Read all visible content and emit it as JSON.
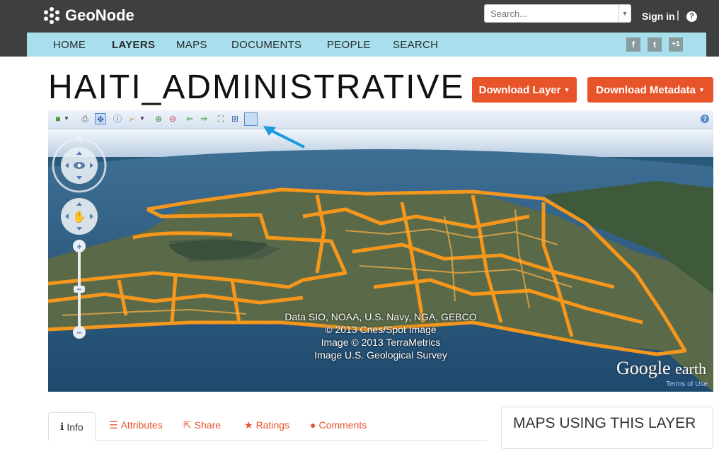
{
  "brand": {
    "name": "GeoNode"
  },
  "search": {
    "placeholder": "Search..."
  },
  "header": {
    "signin": "Sign in",
    "separator": "|",
    "help": "?"
  },
  "nav": {
    "items": [
      {
        "label": "HOME",
        "active": false
      },
      {
        "label": "LAYERS",
        "active": true
      },
      {
        "label": "MAPS",
        "active": false
      },
      {
        "label": "DOCUMENTS",
        "active": false
      },
      {
        "label": "PEOPLE",
        "active": false
      },
      {
        "label": "SEARCH",
        "active": false
      }
    ]
  },
  "social": {
    "facebook": "f",
    "twitter": "t",
    "gplus": "+1"
  },
  "page": {
    "title": "HAITI_ADMINISTRATIVE"
  },
  "actions": {
    "download_layer": "Download Layer",
    "download_metadata": "Download Metadata"
  },
  "map": {
    "compass_north": "N",
    "help": "?",
    "attribution": [
      "Data SIO, NOAA, U.S. Navy, NGA, GEBCO",
      "© 2013 Cnes/Spot Image",
      "Image © 2013 TerraMetrics",
      "Image U.S. Geological Survey"
    ],
    "google": "Google",
    "earth": "earth",
    "terms": "Terms of Use"
  },
  "tabs": [
    {
      "icon": "info-icon",
      "glyph": "ℹ",
      "label": "Info",
      "active": true
    },
    {
      "icon": "list-icon",
      "glyph": "☰",
      "label": "Attributes",
      "active": false
    },
    {
      "icon": "share-icon",
      "glyph": "⇱",
      "label": "Share",
      "active": false
    },
    {
      "icon": "star-icon",
      "glyph": "★",
      "label": "Ratings",
      "active": false
    },
    {
      "icon": "comment-icon",
      "glyph": "●",
      "label": "Comments",
      "active": false
    }
  ],
  "sidebar": {
    "title": "MAPS USING THIS LAYER"
  },
  "colors": {
    "accent": "#e8542a",
    "nav": "#a7e0ec",
    "topbar": "#3f3f3f",
    "outline": "#ff9a1a"
  }
}
